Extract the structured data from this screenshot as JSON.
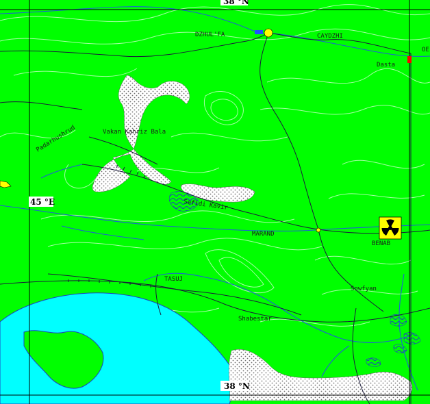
{
  "map": {
    "colors": {
      "land": "#00ff00",
      "water": "#00ffff",
      "salt_flat": "#ffffff",
      "contour": "#9cff9c",
      "road": "#1a1a3a",
      "river": "#1e5fd6",
      "hazard": "#ffff00"
    },
    "coordinates": {
      "top_lat": "38 °N",
      "bottom_lat": "38 °N",
      "left_lon": "45 °E"
    },
    "places": {
      "dzhulfa": "DZHUL'FA",
      "caydzhi": "CAYDZHI",
      "dasta": "Dasta",
      "vakan_kahriz": "Vakan Kahriz Bala",
      "padar": "Padarhushrud",
      "marand": "MARAND",
      "benab": "BENAB",
      "tasuj": "TASUJ",
      "sowfyan": "Sowfyan",
      "shabestar": "Shabestar",
      "orumiyeh_edge": "OE",
      "salt_label": "Sefidi Kavir"
    },
    "icons": {
      "radiation": "radiation-hazard-icon"
    }
  }
}
